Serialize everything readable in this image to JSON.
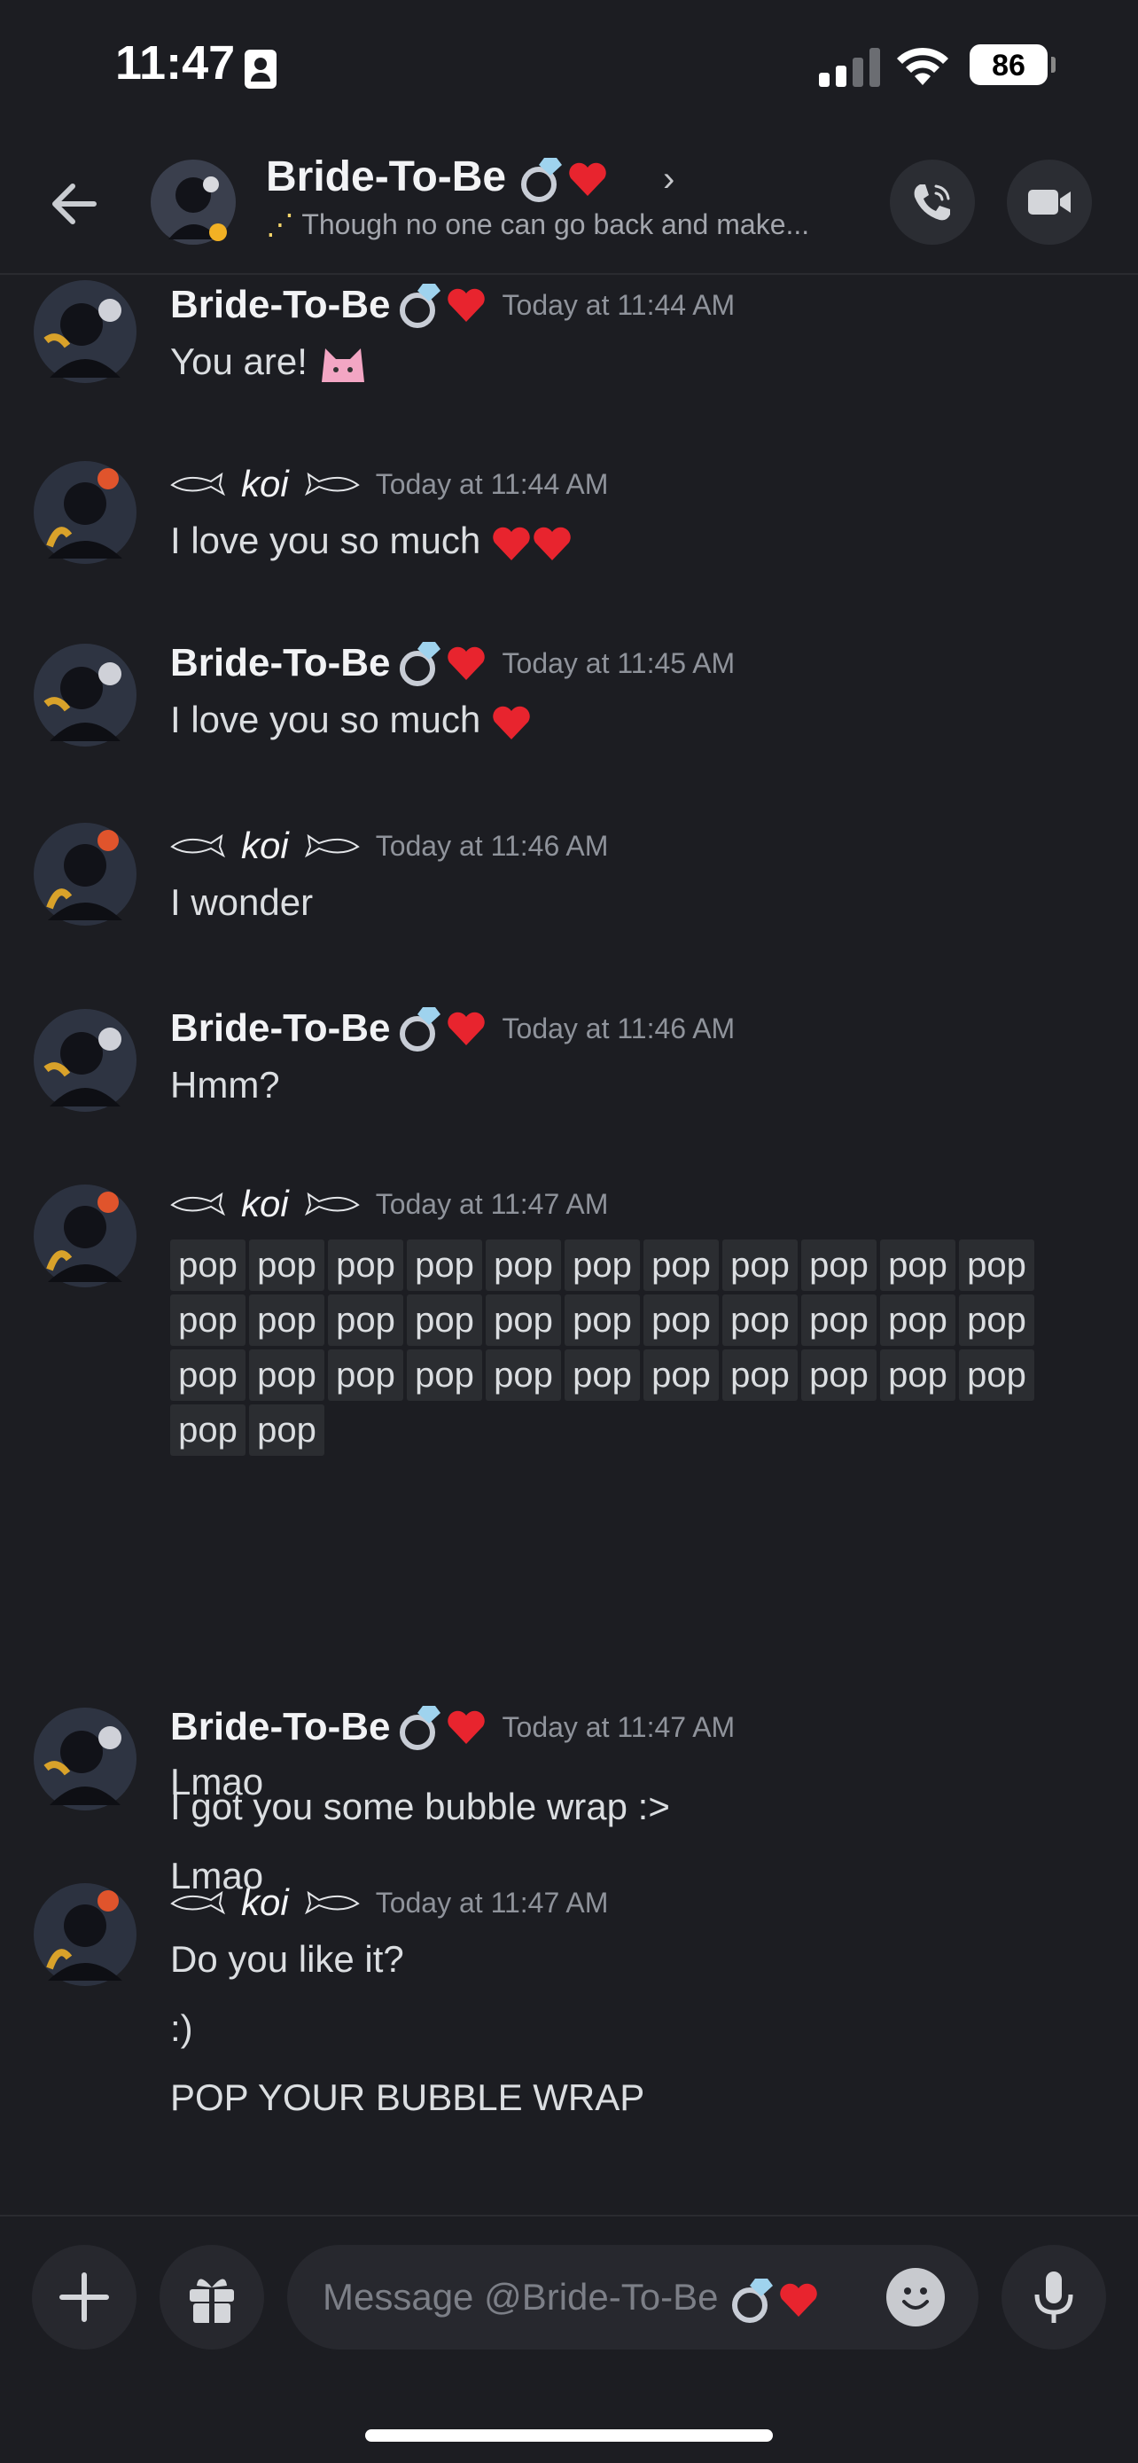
{
  "status_bar": {
    "time": "11:47",
    "battery": "86"
  },
  "header": {
    "title": "Bride-To-Be",
    "status": "Though no one can go back and make..."
  },
  "messages": [
    {
      "author": "Bride-To-Be",
      "time": "Today at 11:44 AM",
      "lines": [
        "You are!"
      ]
    },
    {
      "author": "koi",
      "time": "Today at 11:44 AM",
      "lines": [
        "I love you so much"
      ]
    },
    {
      "author": "Bride-To-Be",
      "time": "Today at 11:45 AM",
      "lines": [
        "I love you so much"
      ]
    },
    {
      "author": "koi",
      "time": "Today at 11:46 AM",
      "lines": [
        "I wonder"
      ]
    },
    {
      "author": "Bride-To-Be",
      "time": "Today at 11:46 AM",
      "lines": [
        "Hmm?"
      ]
    },
    {
      "author": "koi",
      "time": "Today at 11:47 AM",
      "spoiler_word": "pop",
      "spoiler_count": 35,
      "lines": [
        "I got you some bubble wrap :>",
        "Lmao"
      ]
    },
    {
      "author": "Bride-To-Be",
      "time": "Today at 11:47 AM",
      "lines": [
        "Lmao"
      ]
    },
    {
      "author": "koi",
      "time": "Today at 11:47 AM",
      "lines": [
        "Do you like it?",
        ":)",
        "POP YOUR BUBBLE WRAP"
      ]
    }
  ],
  "composer": {
    "placeholder": "Message @Bride-To-Be"
  },
  "colors": {
    "background": "#1c1d22",
    "surface": "#27282e",
    "spoiler": "#2b2d31",
    "heart": "#e8242e"
  },
  "icons": [
    "arrow-left-icon",
    "chevron-right-icon",
    "phone-icon",
    "video-icon",
    "plus-icon",
    "gift-icon",
    "smile-icon",
    "microphone-icon",
    "ring-icon",
    "heart-icon",
    "fish-icon",
    "sparkle-icon",
    "moon-icon"
  ]
}
